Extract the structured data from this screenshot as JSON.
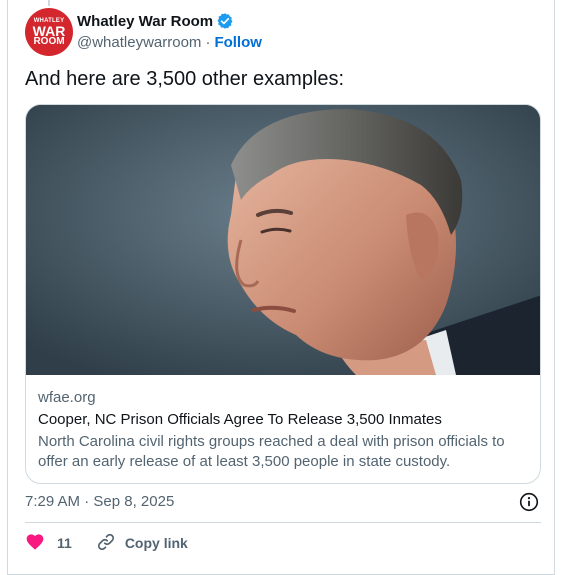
{
  "author": {
    "name": "Whatley War Room",
    "handle": "@whatleywarroom",
    "follow_label": "Follow",
    "avatar_lines": [
      "WHATLEY",
      "WAR",
      "ROOM"
    ]
  },
  "tweet": {
    "text": "And here are 3,500 other examples:"
  },
  "link_card": {
    "domain": "wfae.org",
    "title": "Cooper, NC Prison Officials Agree To Release 3,500 Inmates",
    "description": "North Carolina civil rights groups reached a deal with prison officials to offer an early release of at least 3,500 people in state custody."
  },
  "meta": {
    "time": "7:29 AM",
    "separator": "·",
    "date": "Sep 8, 2025"
  },
  "actions": {
    "like_count": "11",
    "copy_link_label": "Copy link"
  },
  "colors": {
    "accent_blue": "#006fd6",
    "verified_blue": "#1d9bf0",
    "like_pink": "#f91880",
    "avatar_red": "#d3262d",
    "secondary_text": "#536471"
  }
}
